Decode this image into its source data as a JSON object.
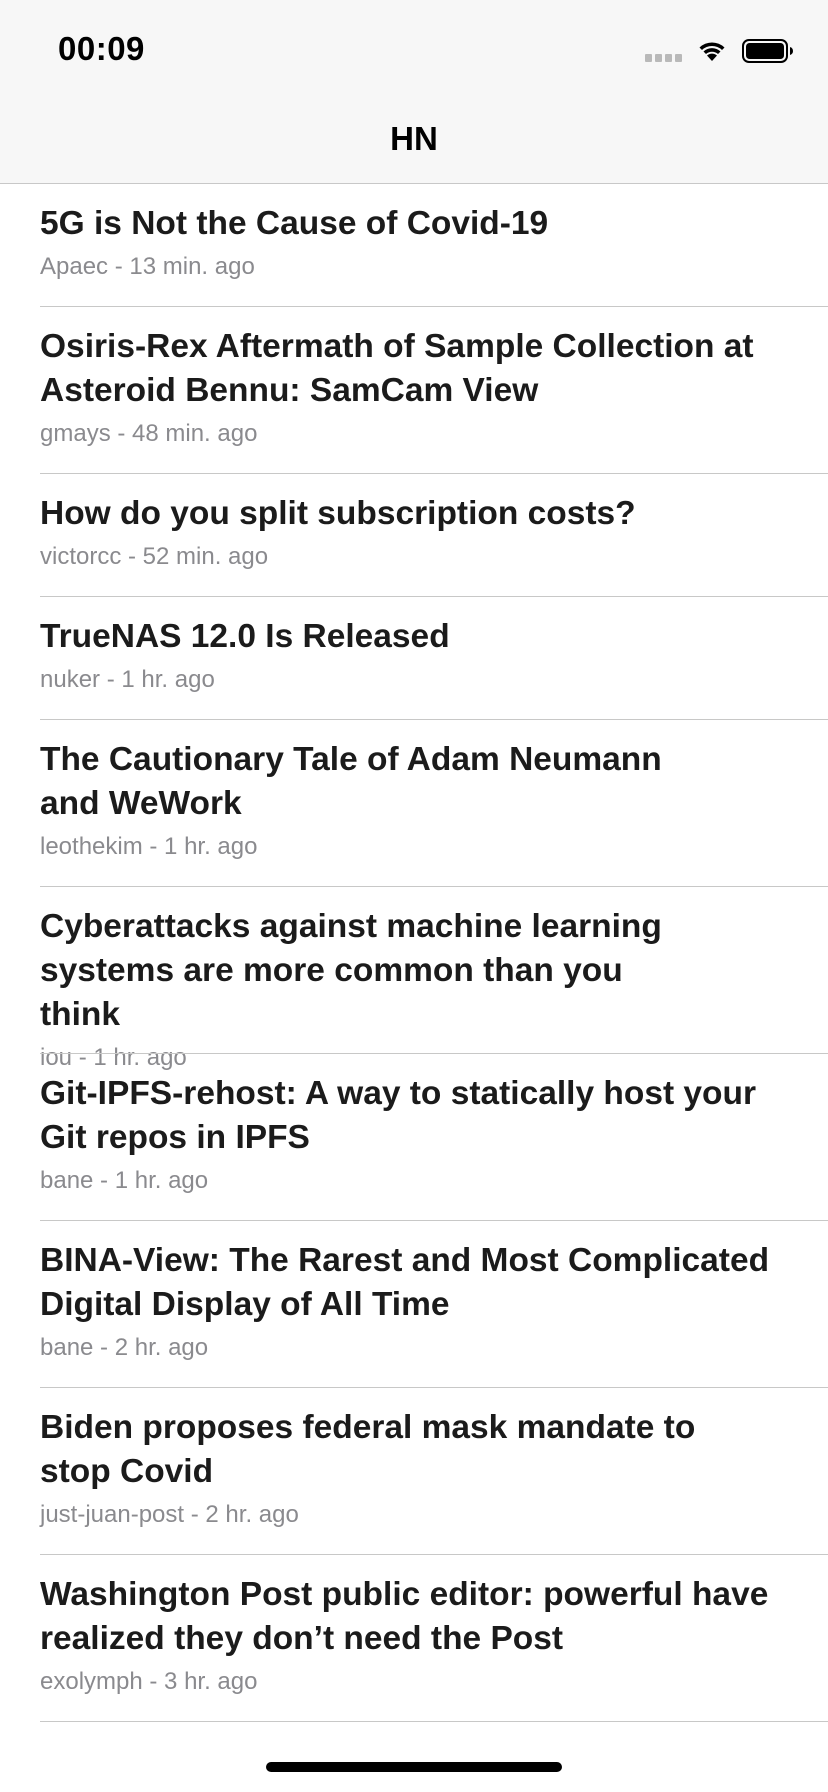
{
  "status_bar": {
    "time": "00:09"
  },
  "nav": {
    "title": "HN"
  },
  "stories": [
    {
      "title": "5G is Not the Cause of Covid-19",
      "author": "Apaec",
      "age": "13 min. ago"
    },
    {
      "title": "Osiris-Rex Aftermath of Sample Collection at Asteroid Bennu: SamCam View",
      "author": "gmays",
      "age": "48 min. ago"
    },
    {
      "title": "How do you split subscription costs?",
      "author": "victorcc",
      "age": "52 min. ago"
    },
    {
      "title": "TrueNAS 12.0 Is Released",
      "author": "nuker",
      "age": "1 hr. ago"
    },
    {
      "title": "The Cautionary Tale of Adam Neumann and WeWork",
      "author": "leothekim",
      "age": "1 hr. ago"
    },
    {
      "title": "Cyberattacks against machine learning systems are more common than you think",
      "author": "iou",
      "age": "1 hr. ago"
    },
    {
      "title": "Git-IPFS-rehost: A way to statically host your Git repos in IPFS",
      "author": "bane",
      "age": "1 hr. ago"
    },
    {
      "title": "BINA-View: The Rarest and Most Complicated Digital Display of All Time",
      "author": "bane",
      "age": "2 hr. ago"
    },
    {
      "title": "Biden proposes federal mask mandate to stop Covid",
      "author": "just-juan-post",
      "age": "2 hr. ago"
    },
    {
      "title": "Washington Post public editor: powerful have realized they don’t need the Post",
      "author": "exolymph",
      "age": "3 hr. ago"
    }
  ],
  "meta_separator": " - ",
  "icons": {
    "signal": "cellular-signal-icon",
    "wifi": "wifi-icon",
    "battery": "battery-icon"
  }
}
